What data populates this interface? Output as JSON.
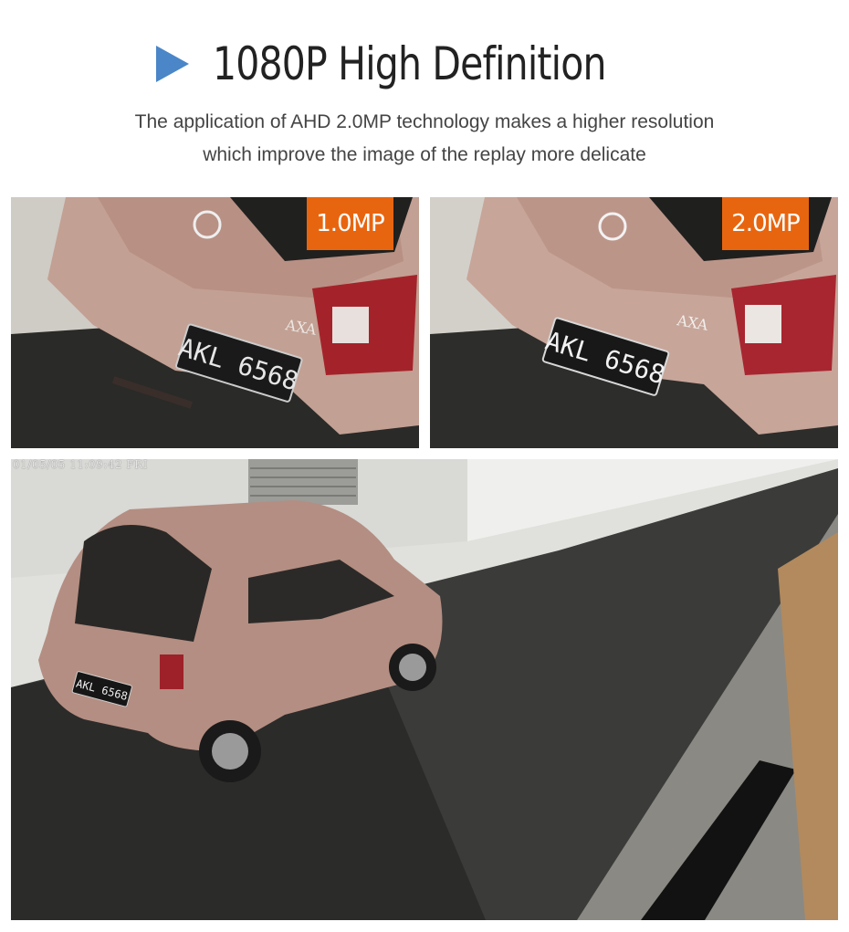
{
  "header": {
    "title": "1080P High Definition",
    "icon": "play-icon",
    "accent_color": "#4a86c8"
  },
  "subtitle": {
    "line1": "The application of AHD 2.0MP technology makes a higher resolution",
    "line2": "which improve the image of the replay more delicate"
  },
  "comparison": {
    "left": {
      "badge": "1.0MP",
      "plate": "AKL 6568"
    },
    "right": {
      "badge": "2.0MP",
      "plate": "AKL 6568"
    },
    "badge_color": "#e8650f"
  },
  "overview": {
    "timestamp": "01/05/05 11:09:42 FRI",
    "plate": "AKL 6568"
  }
}
